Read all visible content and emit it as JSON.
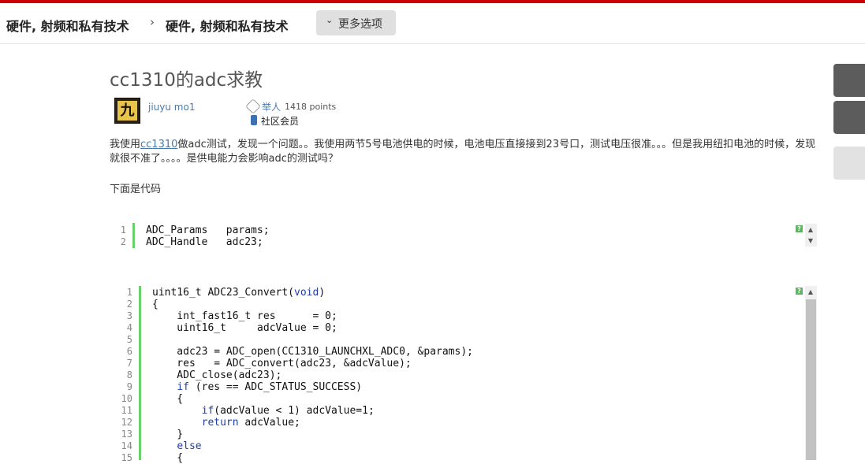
{
  "breadcrumb": {
    "item1": "硬件, 射频和私有技术",
    "separator": "›",
    "item2": "硬件, 射频和私有技术",
    "more_options": "更多选项"
  },
  "post": {
    "title": "cc1310的adc求教",
    "author": {
      "avatar_char": "九",
      "name": "jiuyu mo1",
      "rank": "举人",
      "points": "1418 points",
      "role": "社区会员"
    },
    "paragraph1_before": "我使用",
    "paragraph1_link": "cc1310",
    "paragraph1_after": "做adc测试，发现一个问题。。我使用两节5号电池供电的时候，电池电压直接接到23号口，测试电压很准。。。但是我用纽扣电池的时候，发现就很不准了。。。。是供电能力会影响adc的测试吗？",
    "paragraph2": "下面是代码"
  },
  "code_block_1": {
    "lines": [
      "ADC_Params   params;",
      "ADC_Handle   adc23;"
    ],
    "help": "?"
  },
  "code_block_2": {
    "lines": [
      "uint16_t ADC23_Convert(void)",
      "{",
      "    int_fast16_t res      = 0;",
      "    uint16_t     adcValue = 0;",
      "",
      "    adc23 = ADC_open(CC1310_LAUNCHXL_ADC0, &params);",
      "    res   = ADC_convert(adc23, &adcValue);",
      "    ADC_close(adc23);",
      "    if (res == ADC_STATUS_SUCCESS)",
      "    {",
      "        if(adcValue < 1) adcValue=1;",
      "        return adcValue;",
      "    }",
      "    else",
      "    {"
    ],
    "help": "?"
  },
  "colors": {
    "accent": "#cc0000",
    "link": "#4a7aa8",
    "gutter": "#6ad26a",
    "keyword": "#1f3fa8"
  }
}
